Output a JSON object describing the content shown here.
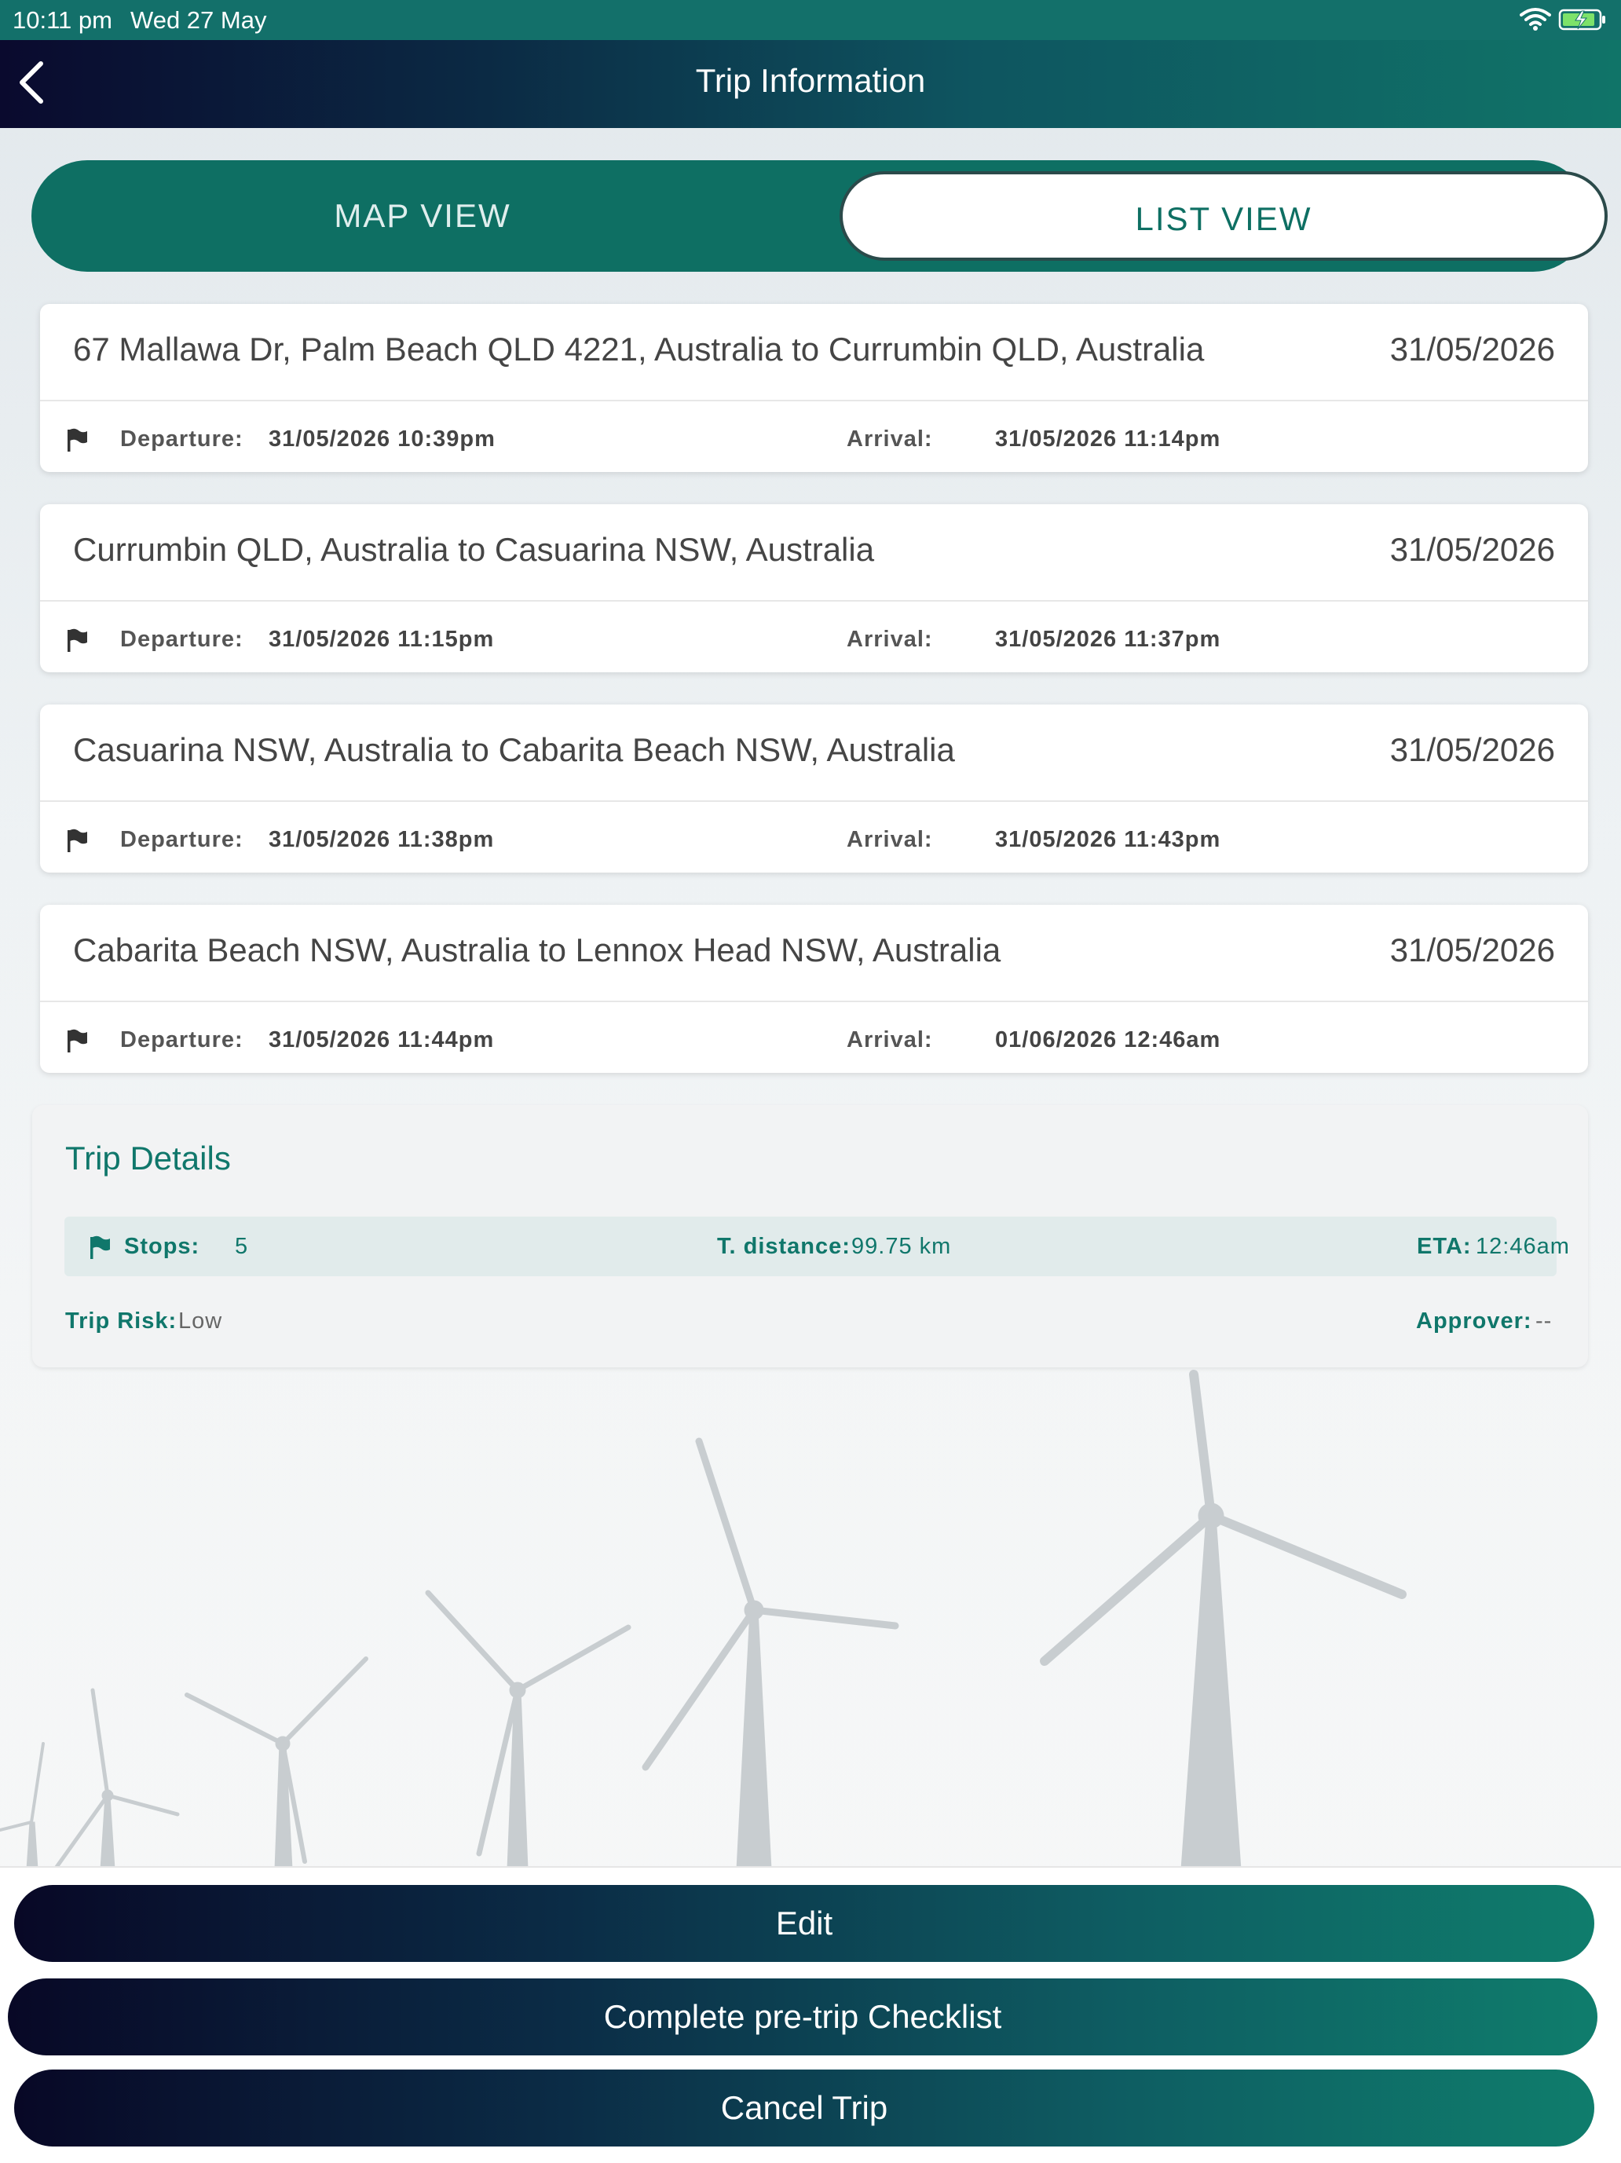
{
  "status_bar": {
    "time": "10:11 pm",
    "date": "Wed 27 May",
    "icons": [
      "wifi-icon",
      "battery-charging-icon"
    ]
  },
  "nav": {
    "title": "Trip Information",
    "back_icon": "chevron-left-icon"
  },
  "segmented": {
    "map_label": "MAP VIEW",
    "list_label": "LIST VIEW",
    "selected": "LIST VIEW"
  },
  "legs": [
    {
      "route": "67 Mallawa Dr, Palm Beach QLD 4221, Australia to Currumbin QLD, Australia",
      "date": "31/05/2026",
      "departure_label": "Departure:",
      "departure": "31/05/2026 10:39pm",
      "arrival_label": "Arrival:",
      "arrival": "31/05/2026 11:14pm"
    },
    {
      "route": "Currumbin QLD, Australia to Casuarina NSW, Australia",
      "date": "31/05/2026",
      "departure_label": "Departure:",
      "departure": "31/05/2026 11:15pm",
      "arrival_label": "Arrival:",
      "arrival": "31/05/2026 11:37pm"
    },
    {
      "route": "Casuarina NSW, Australia to Cabarita Beach NSW, Australia",
      "date": "31/05/2026",
      "departure_label": "Departure:",
      "departure": "31/05/2026 11:38pm",
      "arrival_label": "Arrival:",
      "arrival": "31/05/2026 11:43pm"
    },
    {
      "route": "Cabarita Beach NSW, Australia to Lennox Head NSW, Australia",
      "date": "31/05/2026",
      "departure_label": "Departure:",
      "departure": "31/05/2026 11:44pm",
      "arrival_label": "Arrival:",
      "arrival": "01/06/2026 12:46am"
    }
  ],
  "trip_details": {
    "title": "Trip Details",
    "stops_label": "Stops:",
    "stops": "5",
    "distance_label": "T. distance:",
    "distance": "99.75 km",
    "eta_label": "ETA:",
    "eta": "12:46am",
    "risk_label": "Trip Risk:",
    "risk": "Low",
    "approver_label": "Approver:",
    "approver": "--"
  },
  "actions": {
    "edit": "Edit",
    "checklist": "Complete pre-trip Checklist",
    "cancel": "Cancel Trip"
  },
  "colors": {
    "accent": "#0e6f63",
    "nav_gradient_start": "#0a0a2e",
    "nav_gradient_end": "#107468"
  }
}
